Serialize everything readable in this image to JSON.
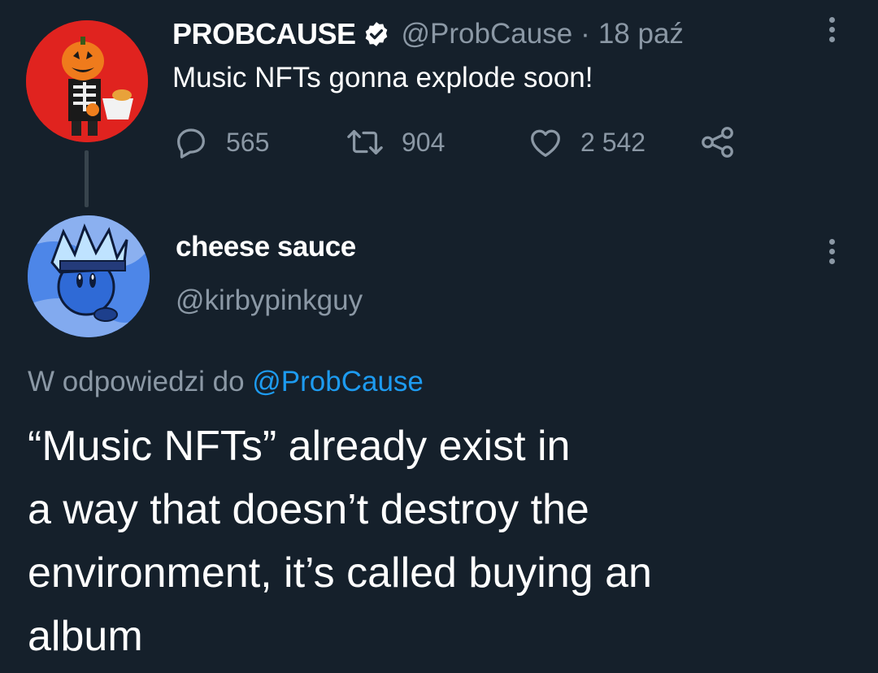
{
  "tweet1": {
    "display_name": "PROBCAUSE",
    "handle": "@ProbCause",
    "separator": "·",
    "date": "18 paź",
    "verified_icon": "verified-badge-icon",
    "text": "Music NFTs gonna explode soon!",
    "avatar_color": "#e0231f",
    "actions": {
      "replies": "565",
      "retweets": "904",
      "likes": "2 542"
    }
  },
  "tweet2": {
    "display_name": "cheese sauce",
    "handle": "@kirbypinkguy",
    "reply_prefix": "W odpowiedzi do ",
    "reply_to_handle": "@ProbCause",
    "avatar_color": "#3b6fd0",
    "text_lines": [
      "“Music NFTs” already exist in",
      "a way that doesn’t destroy the",
      "environment, it’s called buying an",
      "album"
    ]
  },
  "colors": {
    "background": "#15202b",
    "text_primary": "#ffffff",
    "text_secondary": "#8b98a5",
    "link": "#1d9bf0",
    "thread_line": "#38444d"
  }
}
